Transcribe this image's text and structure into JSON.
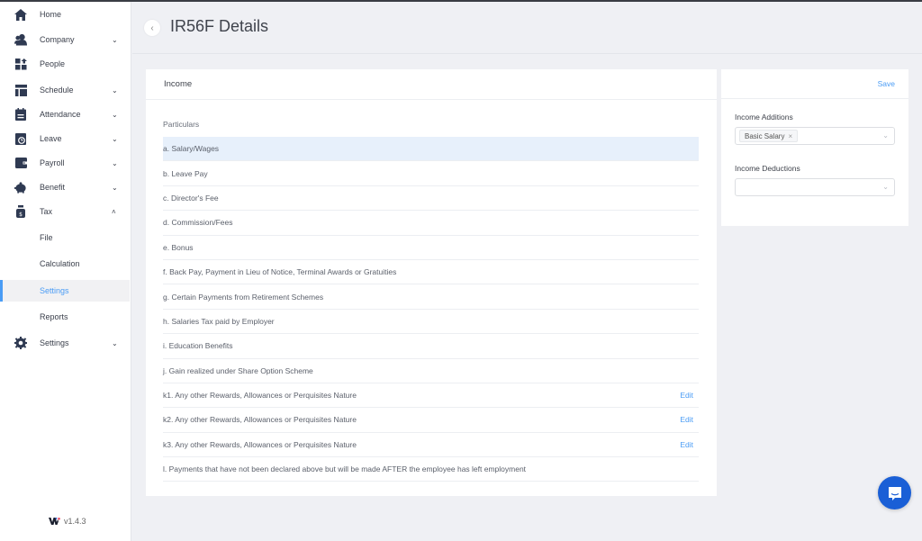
{
  "sidebar": {
    "items": [
      {
        "label": "Home",
        "icon": "home-icon",
        "chevron": ""
      },
      {
        "label": "Company",
        "icon": "company-icon",
        "chevron": "⌄"
      },
      {
        "label": "People",
        "icon": "people-icon",
        "chevron": ""
      },
      {
        "label": "Schedule",
        "icon": "schedule-icon",
        "chevron": "⌄"
      },
      {
        "label": "Attendance",
        "icon": "attendance-icon",
        "chevron": "⌄"
      },
      {
        "label": "Leave",
        "icon": "leave-icon",
        "chevron": "⌄"
      },
      {
        "label": "Payroll",
        "icon": "payroll-icon",
        "chevron": "⌄"
      },
      {
        "label": "Benefit",
        "icon": "benefit-icon",
        "chevron": "⌄"
      },
      {
        "label": "Tax",
        "icon": "tax-icon",
        "chevron": "˄"
      }
    ],
    "tax_subitems": [
      {
        "label": "File"
      },
      {
        "label": "Calculation"
      },
      {
        "label": "Settings",
        "active": true
      },
      {
        "label": "Reports"
      }
    ],
    "settings": {
      "label": "Settings",
      "chevron": "⌄"
    },
    "version": "v1.4.3",
    "accent": "#4a9cf5"
  },
  "header": {
    "back_glyph": "‹",
    "title": "IR56F Details"
  },
  "income": {
    "title": "Income",
    "column_header": "Particulars",
    "rows": [
      {
        "label": "a. Salary/Wages",
        "highlight": true,
        "edit": ""
      },
      {
        "label": "b. Leave Pay",
        "edit": ""
      },
      {
        "label": "c. Director's Fee",
        "edit": ""
      },
      {
        "label": "d. Commission/Fees",
        "edit": ""
      },
      {
        "label": "e. Bonus",
        "edit": ""
      },
      {
        "label": "f. Back Pay, Payment in Lieu of Notice, Terminal Awards or Gratuities",
        "edit": ""
      },
      {
        "label": "g. Certain Payments from Retirement Schemes",
        "edit": ""
      },
      {
        "label": "h. Salaries Tax paid by Employer",
        "edit": ""
      },
      {
        "label": "i. Education Benefits",
        "edit": ""
      },
      {
        "label": "j. Gain realized under Share Option Scheme",
        "edit": ""
      },
      {
        "label": "k1. Any other Rewards, Allowances or Perquisites Nature",
        "edit": "Edit"
      },
      {
        "label": "k2. Any other Rewards, Allowances or Perquisites Nature",
        "edit": "Edit"
      },
      {
        "label": "k3. Any other Rewards, Allowances or Perquisites Nature",
        "edit": "Edit"
      },
      {
        "label": "l. Payments that have not been declared above but will be made AFTER the employee has left employment",
        "edit": ""
      }
    ]
  },
  "side_panel": {
    "save_label": "Save",
    "additions_label": "Income Additions",
    "additions_tags": [
      "Basic Salary"
    ],
    "tag_remove_glyph": "×",
    "deductions_label": "Income Deductions",
    "deductions_value": "",
    "chevron_glyph": "⌄"
  },
  "chat": {
    "icon": "chat-icon",
    "color": "#1a5fd6"
  }
}
